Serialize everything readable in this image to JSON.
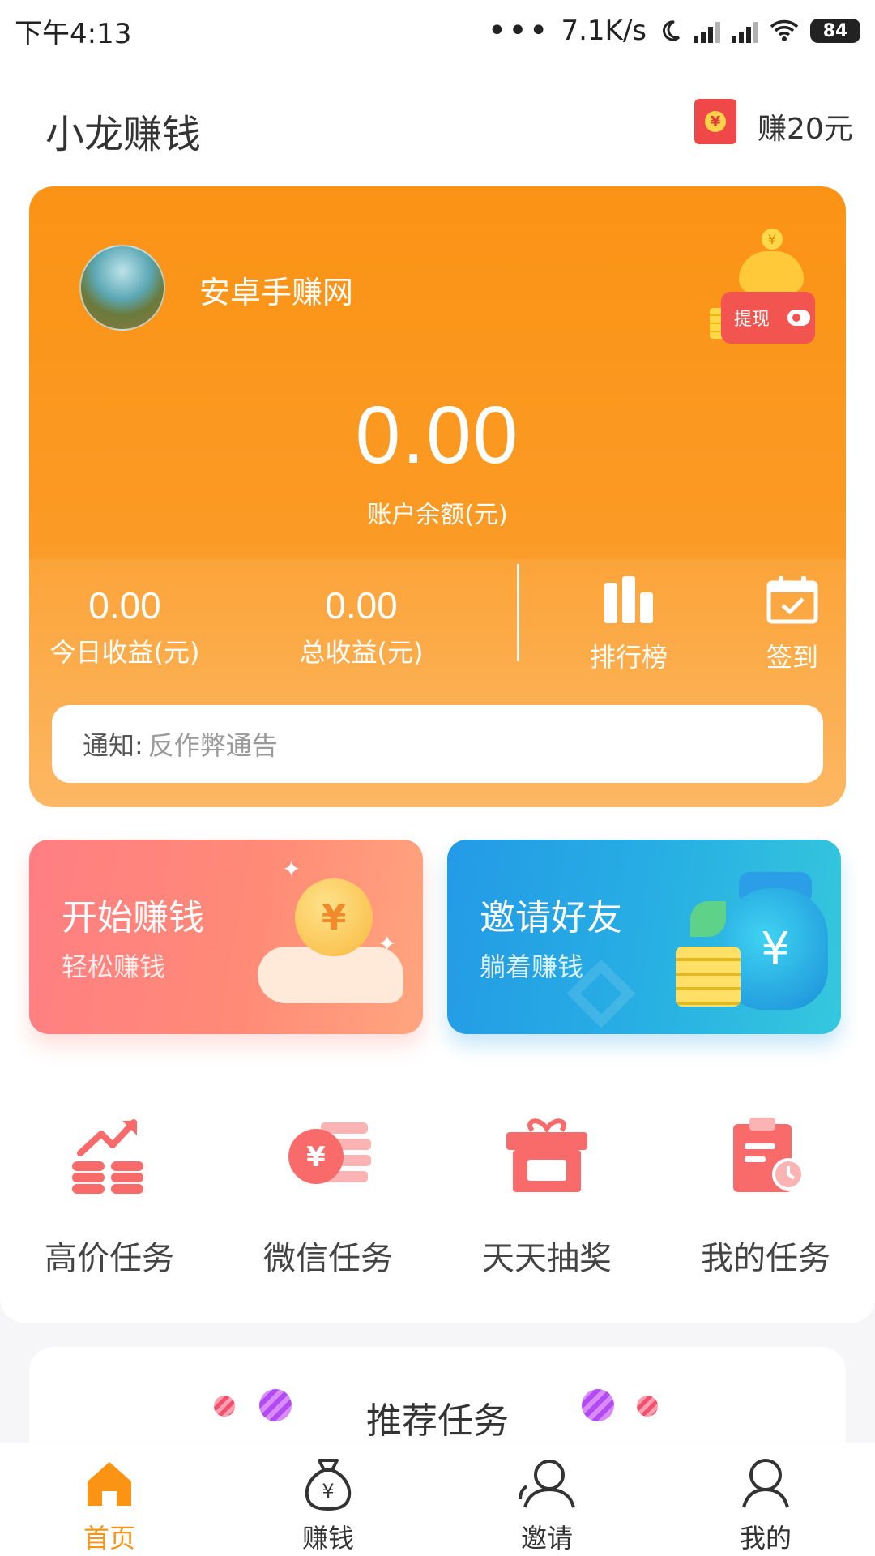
{
  "status_bar": {
    "time": "下午4:13",
    "dots": "•••",
    "net_speed": "7.1K/s",
    "moon_icon": "moon-icon",
    "battery": "84"
  },
  "header": {
    "title": "小龙赚钱",
    "earn_badge": "赚20元",
    "earn_icon": "red-envelope-icon",
    "earn_icon_glyph": "¥"
  },
  "account": {
    "username": "安卓手赚网",
    "withdraw_label": "提现",
    "coin_glyph": "¥",
    "balance": "0.00",
    "balance_label": "账户余额(元)",
    "today_value": "0.00",
    "today_label": "今日收益(元)",
    "total_value": "0.00",
    "total_label": "总收益(元)",
    "ranking_label": "排行榜",
    "checkin_label": "签到"
  },
  "notice": {
    "label": "通知:",
    "text": "反作弊通告"
  },
  "banners": {
    "earn": {
      "title": "开始赚钱",
      "subtitle": "轻松赚钱",
      "glyph": "¥"
    },
    "invite": {
      "title": "邀请好友",
      "subtitle": "躺着赚钱",
      "glyph": "¥"
    }
  },
  "tasks": [
    {
      "label": "高价任务",
      "icon": "chart-coins-icon"
    },
    {
      "label": "微信任务",
      "icon": "yuan-coin-icon",
      "glyph": "¥"
    },
    {
      "label": "天天抽奖",
      "icon": "gift-box-icon"
    },
    {
      "label": "我的任务",
      "icon": "clipboard-clock-icon"
    }
  ],
  "recommended": {
    "title": "推荐任务"
  },
  "bottom_nav": [
    {
      "label": "首页",
      "icon": "home-icon",
      "active": true
    },
    {
      "label": "赚钱",
      "icon": "money-bag-icon",
      "glyph": "¥",
      "active": false
    },
    {
      "label": "邀请",
      "icon": "invite-person-icon",
      "active": false
    },
    {
      "label": "我的",
      "icon": "person-icon",
      "active": false
    }
  ],
  "colors": {
    "accent": "#fb9315",
    "task_icon": "#f96b6b",
    "banner_left": "#ff7e83",
    "banner_right": "#239ae6"
  }
}
